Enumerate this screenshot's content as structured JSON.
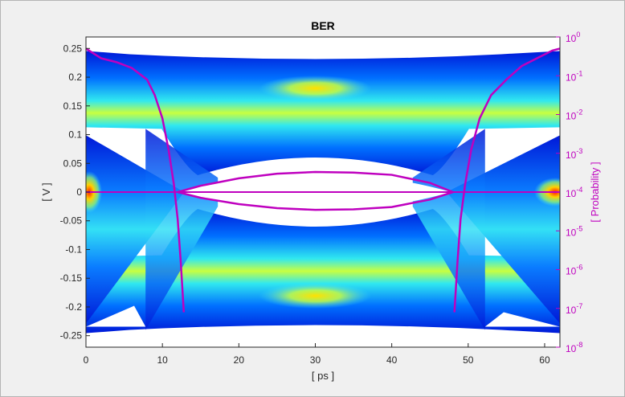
{
  "chart_data": {
    "type": "eye-diagram",
    "title": "BER",
    "xlabel": "[ ps ]",
    "ylabel": "[ V ]",
    "y2label": "[ Probability ]",
    "xlim": [
      0,
      62
    ],
    "ylim": [
      -0.27,
      0.27
    ],
    "y2lim_log10": [
      -8,
      0
    ],
    "y2scale": "log",
    "xticks": [
      0,
      10,
      20,
      30,
      40,
      50,
      60
    ],
    "yticks": [
      0.25,
      0.2,
      0.15,
      0.1,
      0.05,
      0,
      -0.05,
      -0.1,
      -0.15,
      -0.2,
      -0.25
    ],
    "ytick_labels": [
      "0.25",
      "0.2",
      "0.15",
      "0.1",
      "0.05",
      "0",
      "-0.05",
      "-0.1",
      "-0.15",
      "-0.2",
      "-0.25"
    ],
    "y2ticks_exp": [
      0,
      -1,
      -2,
      -3,
      -4,
      -5,
      -6,
      -7,
      -8
    ],
    "y2tick_base": "10",
    "eye": {
      "upper_rail_v": [
        0.11,
        0.24
      ],
      "lower_rail_v": [
        -0.24,
        -0.11
      ],
      "crossing_ps": [
        12,
        48
      ],
      "opening_v": [
        -0.035,
        0.035
      ]
    },
    "series": [
      {
        "label": "eye-contour",
        "color": "#bf00bf",
        "x": [
          12,
          15,
          20,
          25,
          30,
          35,
          40,
          45,
          48
        ],
        "upper_v": [
          0,
          0.011,
          0.024,
          0.032,
          0.035,
          0.034,
          0.03,
          0.016,
          0
        ],
        "lower_v": [
          0,
          -0.01,
          -0.021,
          -0.028,
          -0.031,
          -0.03,
          -0.026,
          -0.013,
          0
        ]
      },
      {
        "label": "threshold",
        "color": "#bf00bf",
        "x": [
          0,
          62
        ],
        "y_v": [
          0,
          0
        ]
      },
      {
        "label": "bathtub-left",
        "color": "#bf00bf",
        "x": [
          0,
          2,
          4,
          6,
          8,
          9,
          10,
          10.8,
          11.5,
          12,
          12.4,
          12.8
        ],
        "log10_p": [
          -0.3,
          -0.55,
          -0.65,
          -0.8,
          -1.1,
          -1.5,
          -2.1,
          -2.9,
          -3.8,
          -4.7,
          -5.8,
          -7.1
        ]
      },
      {
        "label": "bathtub-right",
        "color": "#bf00bf",
        "x": [
          48.2,
          48.6,
          49,
          49.6,
          50.4,
          51.5,
          53,
          55,
          57,
          59,
          61,
          62
        ],
        "log10_p": [
          -7.1,
          -5.8,
          -4.7,
          -3.8,
          -2.9,
          -2.1,
          -1.5,
          -1.1,
          -0.75,
          -0.55,
          -0.35,
          -0.3
        ]
      }
    ]
  }
}
